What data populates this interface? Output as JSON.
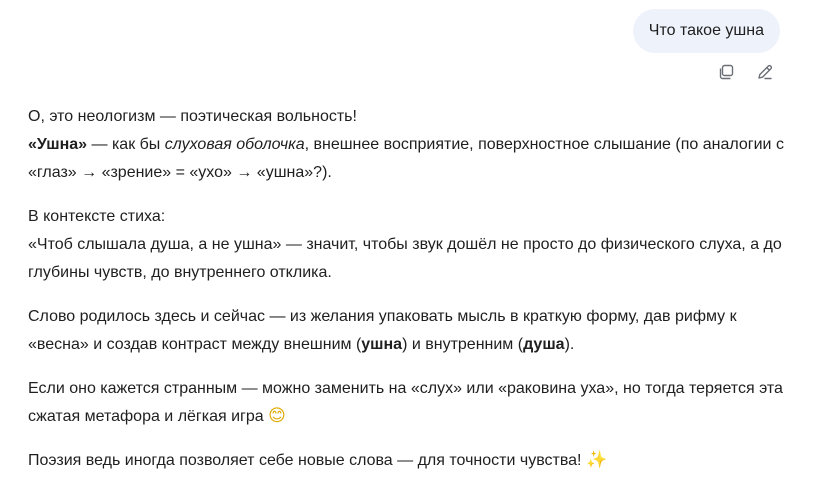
{
  "user_message": {
    "text": "Что такое ушна"
  },
  "icons": {
    "copy": "copy-icon",
    "edit": "pencil-icon"
  },
  "assistant": {
    "p1": {
      "line1": "О, это неологизм — поэтическая вольность!",
      "bold_term": "«Ушна»",
      "t1": " — как бы ",
      "italic": "слуховая оболочка",
      "t2": ", внешнее восприятие, поверхностное слышание (по аналогии с «глаз» → «зрение» = «ухо» → «ушна»?)."
    },
    "p2": {
      "line1": "В контексте стиха:",
      "line2": "«Чтоб слышала душа, а не ушна» — значит, чтобы звук дошёл не просто до физического слуха, а до глубины чувств, до внутреннего отклика."
    },
    "p3": {
      "t1": "Слово родилось здесь и сейчас — из желания упаковать мысль в краткую форму, дав рифму к «весна» и создав контраст между внешним (",
      "b1": "ушна",
      "t2": ") и внутренним (",
      "b2": "душа",
      "t3": ")."
    },
    "p4": {
      "text": "Если оно кажется странным — можно заменить на «слух» или «раковина уха», но тогда теряется эта сжатая метафора и лёгкая игра ",
      "emoji": "😊"
    },
    "p5": {
      "text": "Поэзия ведь иногда позволяет себе новые слова — для точности чувства! ",
      "emoji": "✨"
    }
  }
}
